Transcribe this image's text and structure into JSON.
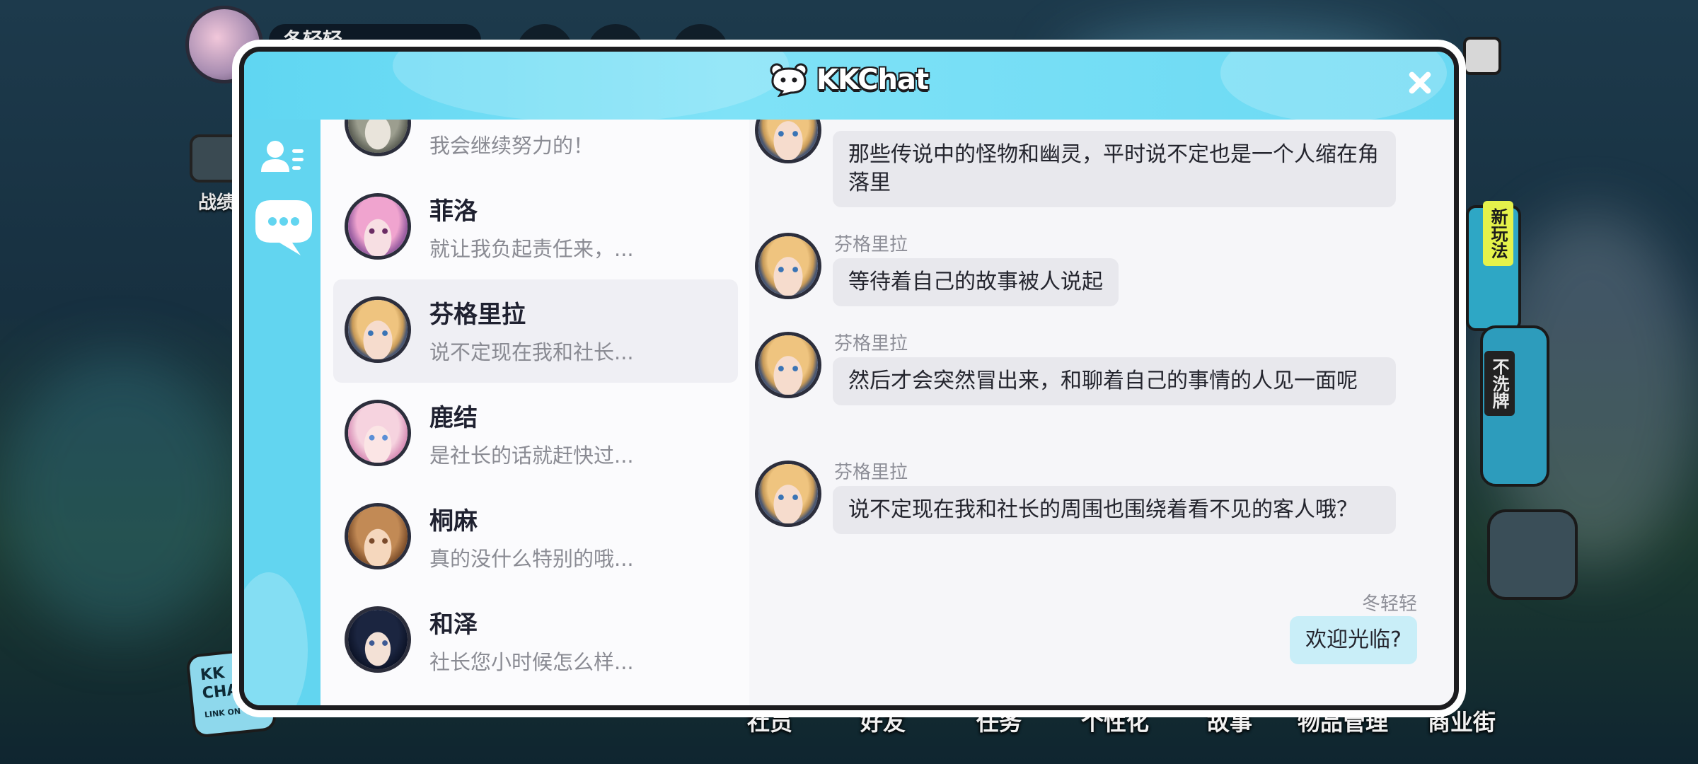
{
  "background": {
    "player_name": "冬轻轻",
    "left_button_label": "战绩",
    "tag_new": "新玩法",
    "tag_no_shuffle": "不洗牌",
    "kkchat_icon_text": [
      "KK",
      "CHAT",
      "LINK ON"
    ],
    "bottom_nav": [
      "社员",
      "好友",
      "任务",
      "个性化",
      "故事",
      "物品管理",
      "商业街"
    ]
  },
  "modal": {
    "title": "KKChat",
    "logo_icon": "kkchat-bear-icon",
    "close_icon": "close-icon",
    "accent_color": "#62d5f0"
  },
  "sidebar": {
    "tabs": [
      {
        "name": "contacts",
        "icon": "contacts-icon"
      },
      {
        "name": "chat",
        "icon": "chat-bubble-icon",
        "active": true
      }
    ]
  },
  "contacts": [
    {
      "name": "",
      "preview": "我会继续努力的！",
      "avatar": "gray"
    },
    {
      "name": "菲洛",
      "preview": "就让我负起责任来，...",
      "avatar": "fl"
    },
    {
      "name": "芬格里拉",
      "preview": "说不定现在我和社长...",
      "avatar": "fg",
      "selected": true
    },
    {
      "name": "鹿结",
      "preview": "是社长的话就赶快过...",
      "avatar": "lj"
    },
    {
      "name": "桐麻",
      "preview": "真的没什么特别的哦...",
      "avatar": "tm"
    },
    {
      "name": "和泽",
      "preview": "社长您小时候怎么样...",
      "avatar": "hz"
    }
  ],
  "messages": [
    {
      "sender": "",
      "text": "那些传说中的怪物和幽灵，平时说不定也是一个人缩在角落里",
      "mine": false
    },
    {
      "sender": "芬格里拉",
      "text": "等待着自己的故事被人说起",
      "mine": false
    },
    {
      "sender": "芬格里拉",
      "text": "然后才会突然冒出来，和聊着自己的事情的人见一面呢",
      "mine": false
    },
    {
      "sender": "芬格里拉",
      "text": "说不定现在我和社长的周围也围绕着看不见的客人哦？",
      "mine": false
    },
    {
      "sender": "冬轻轻",
      "text": "欢迎光临?",
      "mine": true
    }
  ]
}
